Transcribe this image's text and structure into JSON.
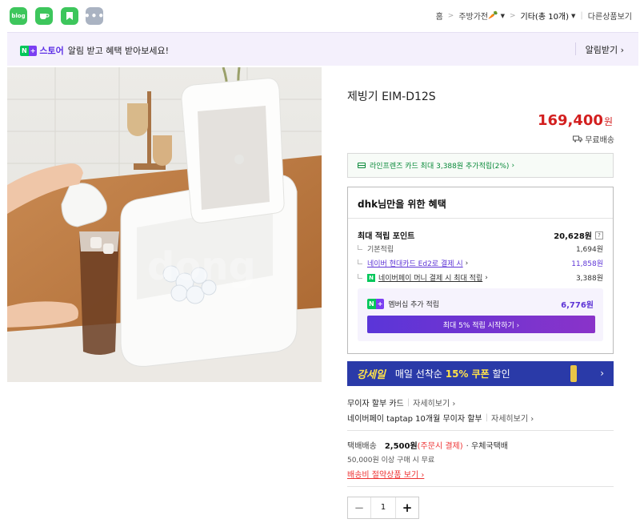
{
  "share": {
    "blog_label": "blog",
    "more_label": "•••",
    "icons": [
      "blog-icon",
      "cafe-icon",
      "bookmark-icon",
      "more-icon"
    ]
  },
  "breadcrumb": {
    "items": [
      "홈",
      "주방가전",
      "기타",
      "(총 10개)",
      "다른상품보기"
    ],
    "emoji": "🥕"
  },
  "alarm": {
    "n_badge": "N",
    "plus_badge": "+",
    "store_label": "스토어",
    "message": "알림 받고 혜택 받아보세요!",
    "button_label": "알림받기",
    "arrow": "›"
  },
  "product": {
    "title": "제빙기 EIM-D12S",
    "price": "169,400",
    "currency": "원",
    "shipping_tag": "무료배송"
  },
  "card_benefit": {
    "text": "라인프렌즈 카드 최대 3,388원 추가적립(2%)",
    "arrow": "›"
  },
  "benefit": {
    "heading": "dhk님만을 위한 혜택",
    "max_label": "최대 적립 포인트",
    "max_value": "20,628원",
    "qmark": "?",
    "rows": [
      {
        "label": "기본적립",
        "value": "1,694원"
      },
      {
        "label": "네이버 현대카드 Ed2로 결제 시",
        "value": "11,858원"
      },
      {
        "label": "네이버페이 머니 결제 시 최대 적립",
        "value": "3,388원"
      }
    ],
    "n_mark": "N",
    "membership_label": "멤버십 추가 적립",
    "membership_value": "6,776원",
    "cta": "최대 5% 적립 시작하기 ›"
  },
  "promo": {
    "logo": "강세일",
    "message_pre": "매일 선착순 ",
    "message_highlight": "15% 쿠폰",
    "message_post": " 할인",
    "arrow": "›"
  },
  "installments": [
    {
      "label": "무이자 할부 카드",
      "more": "자세히보기 ›"
    },
    {
      "label": "네이버페이 taptap 10개월 무이자 할부",
      "more": "자세히보기 ›"
    }
  ],
  "delivery": {
    "label": "택배배송",
    "fee": "2,500원",
    "fee_note": "(주문시 결제)",
    "mode": "· 우체국택배",
    "free_condition": "50,000원 이상 구매 시 무료",
    "saving_link": "배송비 절약상품 보기 ›"
  },
  "quantity": {
    "minus": "−",
    "value": "1",
    "plus": "+"
  },
  "colors": {
    "naver_green": "#03c75a",
    "price_red": "#d31f1f",
    "purple": "#5e35d6",
    "promo_blue": "#2a3aa8"
  }
}
